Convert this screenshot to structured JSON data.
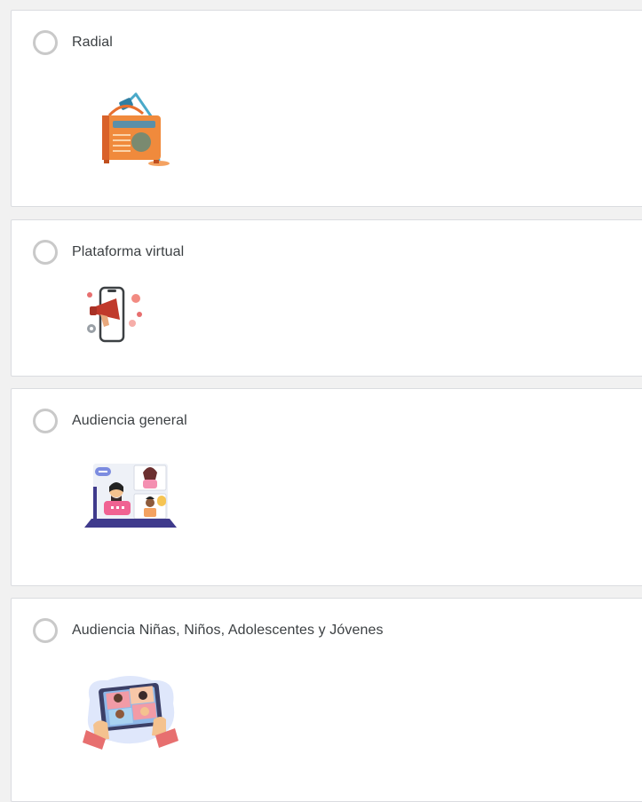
{
  "options": [
    {
      "label": "Radial",
      "icon": "radio-illustration",
      "selected": false
    },
    {
      "label": "Plataforma virtual",
      "icon": "phone-megaphone-illustration",
      "selected": false
    },
    {
      "label": "Audiencia general",
      "icon": "video-call-illustration",
      "selected": false
    },
    {
      "label": "Audiencia Niñas, Niños, Adolescentes y Jóvenes",
      "icon": "tablet-group-illustration",
      "selected": false
    }
  ],
  "colors": {
    "radio_border": "#c9c9c9",
    "card_border": "#dadce0",
    "page_background": "#f1f1f1",
    "label_text": "#3c4043"
  }
}
